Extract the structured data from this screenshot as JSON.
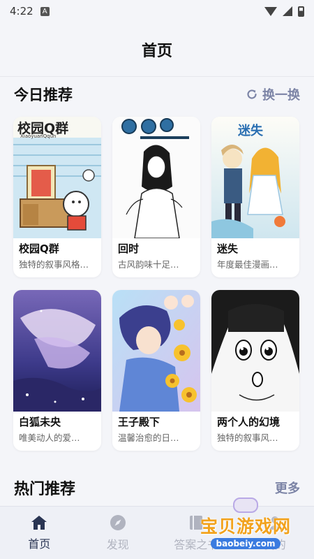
{
  "status_bar": {
    "time": "4:22",
    "notification_badge": "A"
  },
  "header": {
    "title": "首页"
  },
  "today_section": {
    "title": "今日推荐",
    "refresh_label": "换一换"
  },
  "cards": [
    {
      "name": "校园Q群",
      "desc": "独特的叙事风格…",
      "cover_logo": "校园Q群",
      "cover_sub": "XiaoyuanQqun"
    },
    {
      "name": "回时",
      "desc": "古风韵味十足…"
    },
    {
      "name": "迷失",
      "desc": "年度最佳漫画…",
      "cover_logo": "迷失"
    },
    {
      "name": "白狐未央",
      "desc": "唯美动人的爱…"
    },
    {
      "name": "王子殿下",
      "desc": "温馨治愈的日…"
    },
    {
      "name": "两个人的幻境",
      "desc": "独特的叙事风…"
    }
  ],
  "hot_section": {
    "title": "热门推荐",
    "more_label": "更多"
  },
  "nav": [
    {
      "label": "首页",
      "icon": "home-icon",
      "active": true
    },
    {
      "label": "发现",
      "icon": "compass-icon",
      "active": false
    },
    {
      "label": "答案之书",
      "icon": "book-icon",
      "active": false
    },
    {
      "label": "我的",
      "icon": "user-icon",
      "active": false
    }
  ],
  "watermark": {
    "text": "宝贝游戏网",
    "url": "baobeiy.com"
  },
  "colors": {
    "accent": "#7c84a6",
    "nav_active": "#2a3553",
    "nav_inactive": "#b0b3bf",
    "background": "#f4f5f9"
  }
}
